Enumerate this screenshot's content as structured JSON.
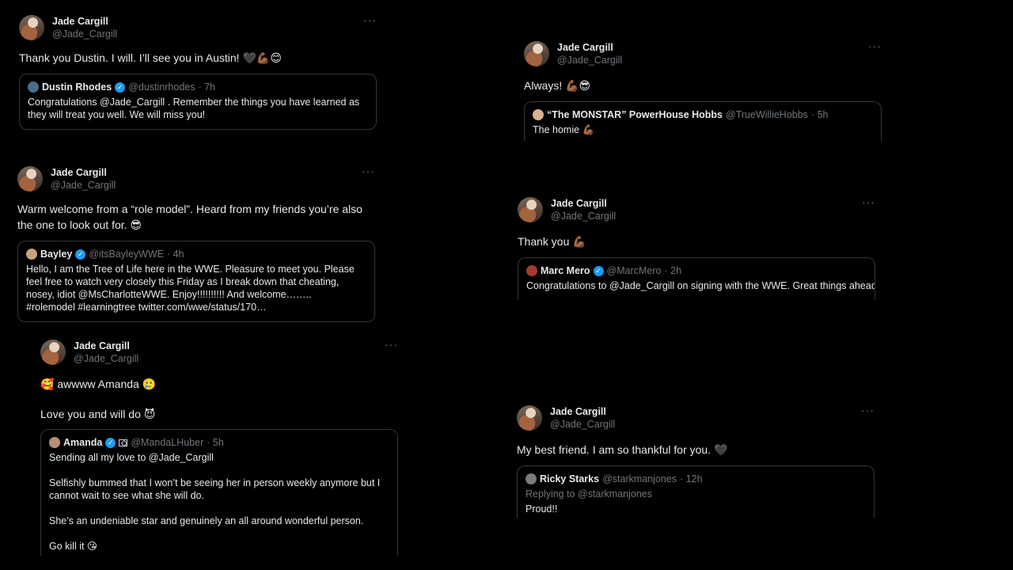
{
  "tweets": [
    {
      "name": "Jade Cargill",
      "handle": "@Jade_Cargill",
      "more": "···",
      "text": "Thank you Dustin. I will. I’ll see you in Austin! 🖤💪🏾😊",
      "quote": {
        "name": "Dustin Rhodes",
        "handle": "@dustinrhodes",
        "time": "· 7h",
        "body": "Congratulations @Jade_Cargill . Remember the things you have learned as they will treat you well. We will miss you!"
      }
    },
    {
      "name": "Jade Cargill",
      "handle": "@Jade_Cargill",
      "more": "···",
      "text": "Warm welcome from a “role model”. Heard from my friends you’re also the one to look out for. 😎",
      "quote": {
        "name": "Bayley",
        "handle": "@itsBayleyWWE",
        "time": "· 4h",
        "body": "Hello, I am the Tree of Life here in the WWE. Pleasure to meet you. Please feel free to watch very closely this Friday as I break down that cheating, nosey, idiot @MsCharlotteWWE. Enjoy!!!!!!!!!! And welcome……..\n#rolemodel #learningtree twitter.com/wwe/status/170…"
      }
    },
    {
      "name": "Jade Cargill",
      "handle": "@Jade_Cargill",
      "more": "···",
      "text": "🥰 awwww Amanda 🥲",
      "text2": "Love you and will do 😈",
      "quote": {
        "name": "Amanda",
        "handle": "@MandaLHuber",
        "time": "· 5h",
        "body": "Sending all my love to @Jade_Cargill\n\nSelfishly bummed that I won’t be seeing her in person weekly anymore but I cannot wait to see what she will do.\n\nShe’s an undeniable star and genuinely an all around wonderful person.\n\nGo kill it 😘"
      }
    },
    {
      "name": "Jade Cargill",
      "handle": "@Jade_Cargill",
      "more": "···",
      "text": "Always! 💪🏾😎",
      "quote": {
        "name": "“The MONSTAR” PowerHouse Hobbs",
        "handle": "@TrueWillieHobbs",
        "time": "· 5h",
        "body": "The homie 💪🏾"
      }
    },
    {
      "name": "Jade Cargill",
      "handle": "@Jade_Cargill",
      "more": "···",
      "text": "Thank you 💪🏾",
      "quote": {
        "name": "Marc Mero",
        "handle": "@MarcMero",
        "time": "· 2h",
        "body": "Congratulations to @Jade_Cargill on signing with the WWE. Great things ahead!"
      }
    },
    {
      "name": "Jade Cargill",
      "handle": "@Jade_Cargill",
      "more": "···",
      "text": "My best friend. I am so thankful for you. 🖤",
      "quote": {
        "name": "Ricky Starks",
        "handle": "@starkmanjones",
        "time": "· 12h",
        "reply": "Replying to @starkmanjones",
        "body": "Proud!!"
      }
    }
  ]
}
